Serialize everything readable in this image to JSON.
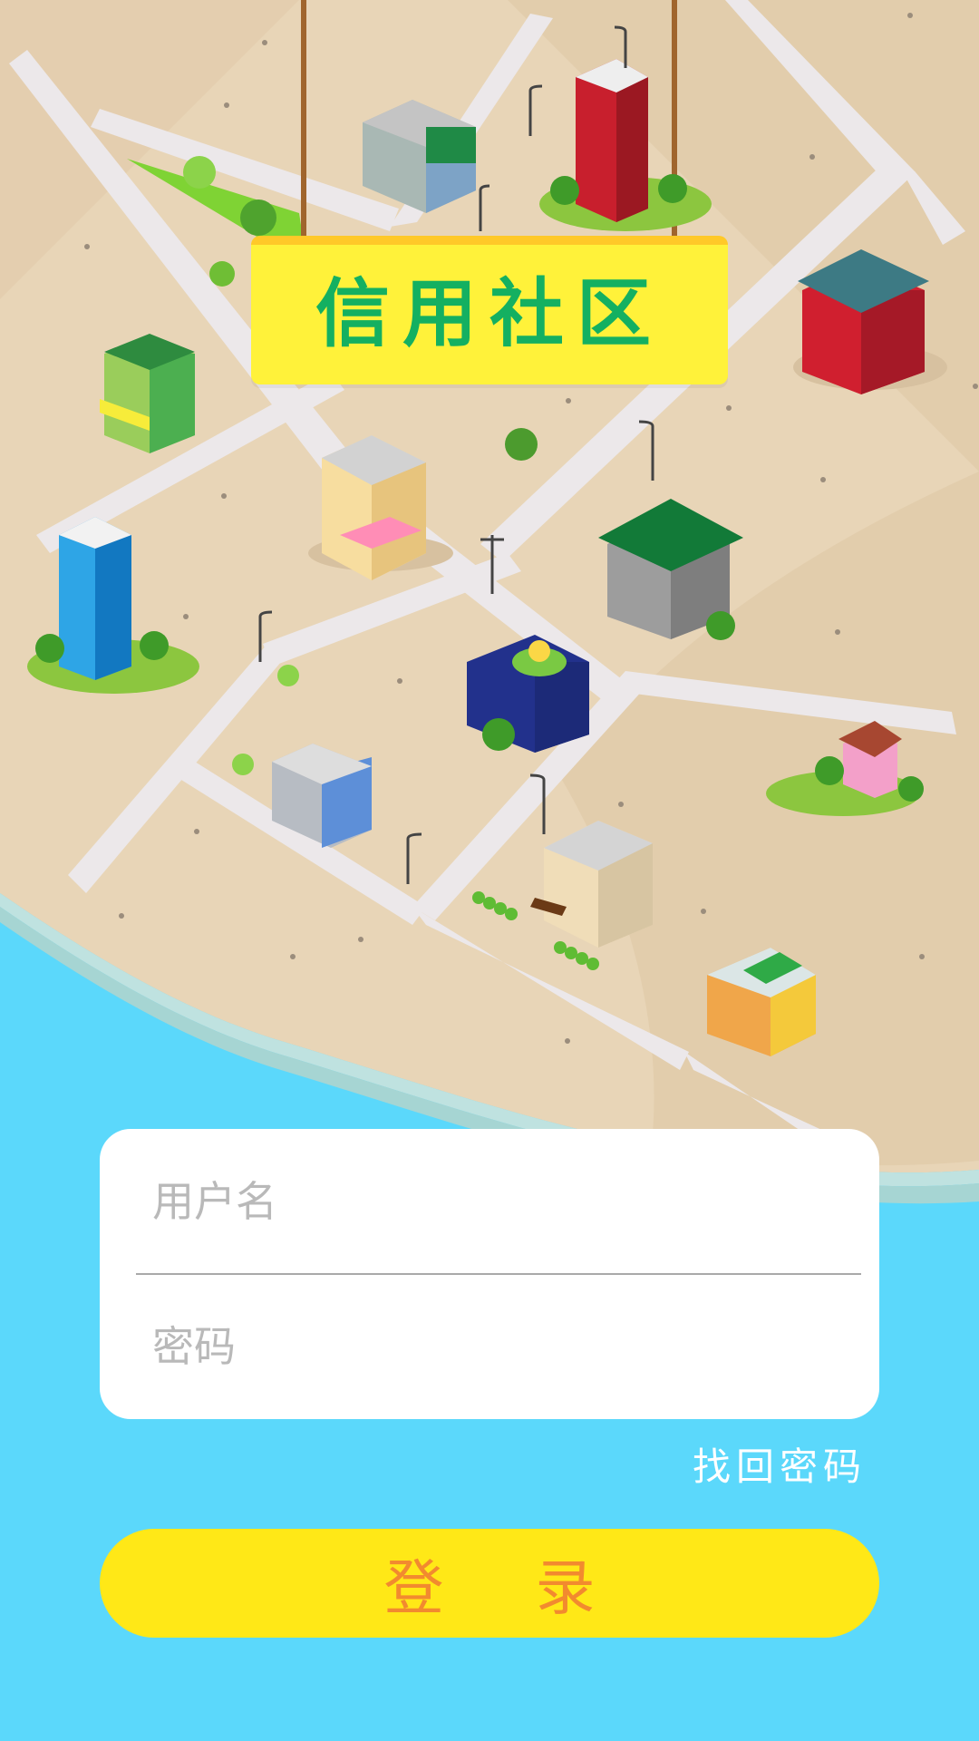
{
  "header": {
    "title": "信用社区"
  },
  "form": {
    "username_placeholder": "用户名",
    "password_placeholder": "密码",
    "forgot_password_label": "找回密码",
    "login_button_label": "登 录"
  },
  "colors": {
    "sea": "#5bd8fb",
    "sand": "#e7d3b5",
    "sign": "#fff23a",
    "title": "#14b061",
    "button": "#ffe817",
    "button_text": "#f28a2f"
  }
}
